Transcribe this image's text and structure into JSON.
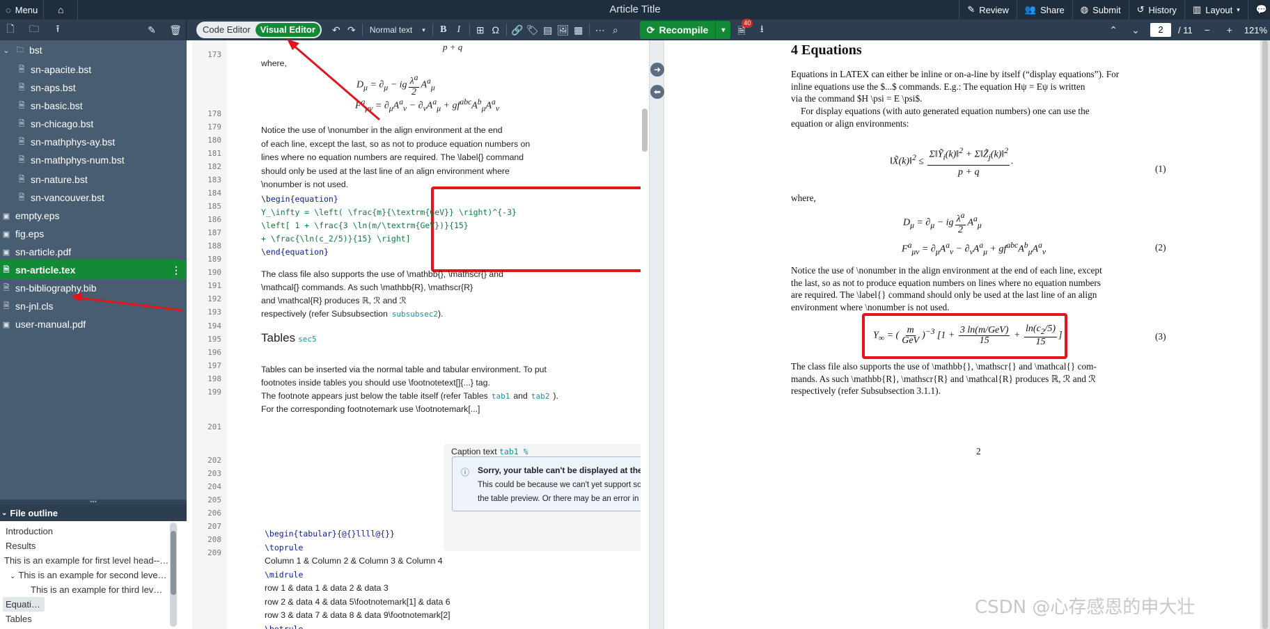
{
  "topbar": {
    "menu_label": "Menu",
    "title": "Article Title",
    "review": "Review",
    "share": "Share",
    "submit": "Submit",
    "history": "History",
    "layout": "Layout"
  },
  "toolbar": {
    "code_editor": "Code Editor",
    "visual_editor": "Visual Editor",
    "style_select": "Normal text",
    "recompile": "Recompile",
    "logs_count": "40",
    "page_current": "2",
    "page_total": "/ 11",
    "zoom": "121%"
  },
  "files": [
    {
      "name": "bst",
      "type": "folder"
    },
    {
      "name": "sn-apacite.bst",
      "type": "file"
    },
    {
      "name": "sn-aps.bst",
      "type": "file"
    },
    {
      "name": "sn-basic.bst",
      "type": "file"
    },
    {
      "name": "sn-chicago.bst",
      "type": "file"
    },
    {
      "name": "sn-mathphys-ay.bst",
      "type": "file"
    },
    {
      "name": "sn-mathphys-num.bst",
      "type": "file"
    },
    {
      "name": "sn-nature.bst",
      "type": "file"
    },
    {
      "name": "sn-vancouver.bst",
      "type": "file"
    },
    {
      "name": "empty.eps",
      "type": "image"
    },
    {
      "name": "fig.eps",
      "type": "image"
    },
    {
      "name": "sn-article.pdf",
      "type": "image"
    },
    {
      "name": "sn-article.tex",
      "type": "file"
    },
    {
      "name": "sn-bibliography.bib",
      "type": "file"
    },
    {
      "name": "sn-jnl.cls",
      "type": "file"
    },
    {
      "name": "user-manual.pdf",
      "type": "image"
    }
  ],
  "outline": {
    "title": "File outline",
    "items": [
      {
        "label": "Introduction"
      },
      {
        "label": "Results"
      },
      {
        "label": "This is an example for first level head---s..."
      },
      {
        "label": "This is an example for second level h..."
      },
      {
        "label": "This is an example for third level..."
      },
      {
        "label": "Equations"
      },
      {
        "label": "Tables"
      }
    ]
  },
  "editor": {
    "lines": [
      {
        "n": "173"
      },
      {
        "n": "178"
      },
      {
        "n": "179"
      },
      {
        "n": "180"
      },
      {
        "n": "181"
      },
      {
        "n": "182"
      },
      {
        "n": "183"
      },
      {
        "n": "184"
      },
      {
        "n": "185"
      },
      {
        "n": "186"
      },
      {
        "n": "187"
      },
      {
        "n": "188"
      },
      {
        "n": "189"
      },
      {
        "n": "190"
      },
      {
        "n": "191"
      },
      {
        "n": "192"
      },
      {
        "n": "193"
      },
      {
        "n": "194"
      },
      {
        "n": "195"
      },
      {
        "n": "196"
      },
      {
        "n": "197"
      },
      {
        "n": "198"
      },
      {
        "n": "199"
      },
      {
        "n": "201"
      },
      {
        "n": "202"
      },
      {
        "n": "203"
      },
      {
        "n": "204"
      },
      {
        "n": "205"
      },
      {
        "n": "206"
      },
      {
        "n": "207"
      },
      {
        "n": "208"
      },
      {
        "n": "209"
      }
    ],
    "top_frac": "p + q",
    "where": "where,",
    "para1": [
      "Notice the use of \\nonumber in the align environment at the end",
      "of each line, except the last, so as not to produce equation numbers on",
      "lines where no equation numbers are required. The \\label{} command",
      "should only be used at the last line of an align environment where",
      "\\nonumber is not used."
    ],
    "eq_code": [
      "\\begin{equation}",
      "Y_\\infty = \\left( \\frac{m}{\\textrm{GeV}} \\right)^{-3}",
      "  \\left[ 1 + \\frac{3 \\ln(m/\\textrm{GeV})}{15}",
      "  + \\frac{\\ln(c_2/5)}{15} \\right]",
      "\\end{equation}"
    ],
    "para2": [
      "The class file also supports the use of \\mathbb{}, \\mathscr{} and",
      "\\mathcal{} commands. As such \\mathbb{R}, \\mathscr{R}",
      "and \\mathcal{R} produces ℝ, ℛ and ℛ",
      "respectively (refer Subsubsection",
      "subsubsec2",
      ")."
    ],
    "tables_heading": "Tables",
    "tables_label": "sec5",
    "para3": [
      "Tables can be inserted via the normal table and tabular environment. To put",
      "footnotes inside tables you should use \\footnotetext[]{...} tag.",
      "The footnote appears just below the table itself (refer Tables",
      "tab1",
      "and",
      "tab2",
      ").",
      "For the corresponding footnotemark use \\footnotemark[...]"
    ],
    "caption": "Caption text",
    "caption_label": "tab1 %",
    "warn_title": "Sorry, your table can't be displayed at the moment.",
    "warn_l1": "This could be because we can't yet support some elements of the table in",
    "warn_l2": "the table preview. Or there may be an error in the table's LaTeX code.",
    "tab_code": [
      "\\begin{tabular}{@{}llll@{}}",
      "\\toprule",
      "Column 1 & Column 2  & Column 3 & Column 4",
      "\\midrule",
      "row 1   & data 1  & data 2  & data 3  ",
      "row 2   & data 4  & data 5\\footnotemark[1]  & data 6  ",
      "row 3   & data 7  & data 8  & data 9\\footnotemark[2]  ",
      "\\botrule"
    ]
  },
  "pdf": {
    "section": "4  Equations",
    "p1": [
      "Equations in LATEX can either be inline or on-a-line by itself (“display equations”). For",
      "inline equations use the $...$ commands. E.g.: The equation Hψ = Eψ is written",
      "via the command $H \\psi = E \\psi$."
    ],
    "p2": [
      "For display equations (with auto generated equation numbers) one can use the",
      "equation or align environments:"
    ],
    "eq1_no": "(1)",
    "where": "where,",
    "eq2_no": "(2)",
    "p3": [
      "Notice the use of \\nonumber in the align environment at the end of each line, except",
      "the last, so as not to produce equation numbers on lines where no equation numbers",
      "are required. The \\label{} command should only be used at the last line of an align",
      "environment where \\nonumber is not used."
    ],
    "eq3_no": "(3)",
    "p4": [
      "The class file also supports the use of \\mathbb{}, \\mathscr{} and \\mathcal{} com-",
      "mands. As such \\mathbb{R}, \\mathscr{R} and \\mathcal{R} produces ℝ, ℛ and ℛ",
      "respectively (refer Subsubsection 3.1.1)."
    ],
    "page_number": "2"
  },
  "watermark": "CSDN @心存感恩的申大壮",
  "colors": {
    "accent": "#138a36",
    "annotation": "#e3141a",
    "topbar": "#1f2e3d"
  }
}
